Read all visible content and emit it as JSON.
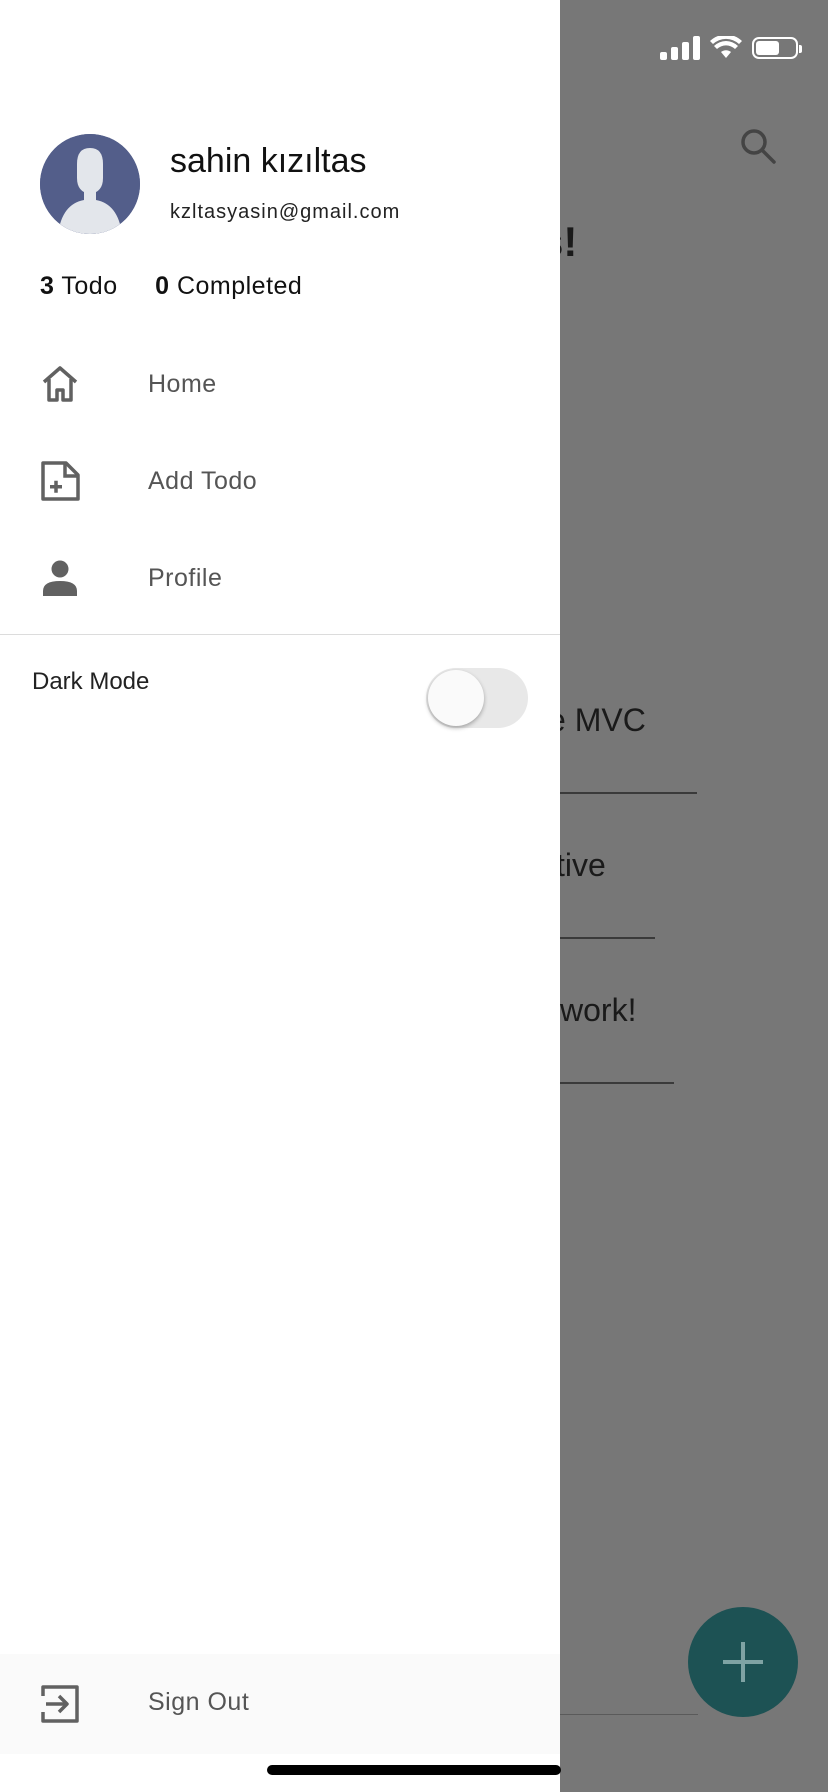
{
  "background": {
    "title_fragment": "s!",
    "items": [
      {
        "text": "e MVC"
      },
      {
        "text": "tive"
      },
      {
        "text": "work!"
      }
    ],
    "fab_icon": "plus-icon",
    "search_icon": "search-icon"
  },
  "status_bar": {
    "signal_icon": "cellular-signal-icon",
    "wifi_icon": "wifi-icon",
    "battery_icon": "battery-icon",
    "battery_level": 0.6
  },
  "drawer": {
    "user": {
      "name": "sahin kızıltas",
      "email": "kzltasyasin@gmail.com",
      "avatar_icon": "default-avatar-icon"
    },
    "stats": {
      "todo_count": "3",
      "todo_label": "Todo",
      "completed_count": "0",
      "completed_label": "Completed"
    },
    "menu": [
      {
        "label": "Home",
        "icon": "home-icon"
      },
      {
        "label": "Add Todo",
        "icon": "note-add-icon"
      },
      {
        "label": "Profile",
        "icon": "person-icon"
      }
    ],
    "dark_mode": {
      "label": "Dark Mode",
      "enabled": false
    },
    "sign_out": {
      "label": "Sign Out",
      "icon": "exit-icon"
    }
  },
  "colors": {
    "scrim": "#777777",
    "fab": "#1d5254",
    "avatar_bg": "#535e8a",
    "menu_text": "#555555",
    "icon": "#616161"
  }
}
